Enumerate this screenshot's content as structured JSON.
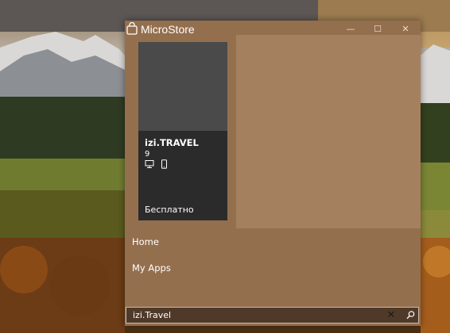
{
  "window": {
    "title": "MicroStore",
    "controls": {
      "minimize": "—",
      "maximize": "☐",
      "close": "✕"
    }
  },
  "app_card": {
    "name": "izi.TRAVEL",
    "rating": "9",
    "price": "Бесплатно",
    "devices": [
      "desktop-icon",
      "mobile-icon"
    ]
  },
  "nav": {
    "home": "Home",
    "my_apps": "My Apps"
  },
  "search": {
    "value": "izi.Travel",
    "clear": "✕"
  },
  "colors": {
    "window_bg": "#946f4e",
    "panel_bg": "#a5805e",
    "card_bg": "#2b2b2b",
    "search_bg": "#4f3a2a"
  }
}
